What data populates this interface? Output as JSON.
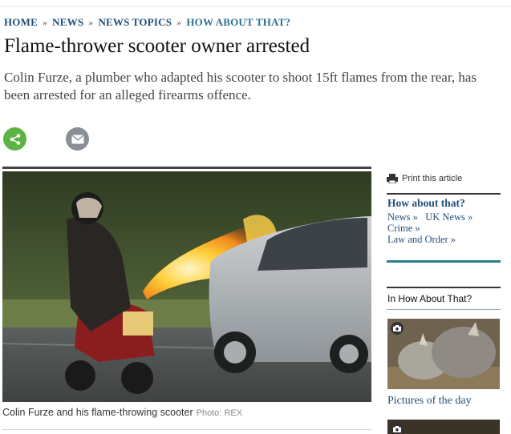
{
  "breadcrumb": {
    "items": [
      "HOME",
      "NEWS",
      "NEWS TOPICS",
      "HOW ABOUT THAT?"
    ],
    "separator": "»"
  },
  "article": {
    "headline": "Flame-thrower scooter owner arrested",
    "standfirst": "Colin Furze, a plumber who adapted his scooter to shoot 15ft flames from the rear, has been arrested for an alleged firearms offence.",
    "caption": "Colin Furze and his flame-throwing scooter",
    "credit": "Photo: REX"
  },
  "share": {
    "share_icon": "share-icon",
    "email_icon": "envelope-icon",
    "share_color": "#5db445",
    "email_color": "#8a8f95"
  },
  "sidebar": {
    "print_label": "Print this article",
    "topic_title": "How about that?",
    "tags": [
      "News »",
      "UK News »",
      "Crime »",
      "Law and Order »"
    ],
    "in_section_title": "In How About That?",
    "gallery_label": "Pictures of the day",
    "accent_color": "#2a7f8f"
  }
}
